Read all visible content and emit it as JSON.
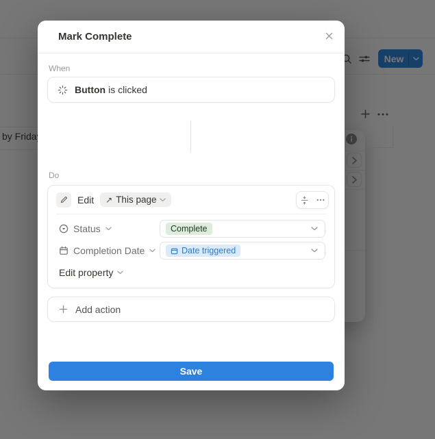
{
  "background": {
    "new_button": "New",
    "table_row_label": "by Friday"
  },
  "modal": {
    "title": "Mark Complete",
    "when": {
      "label": "When",
      "trigger_subject": "Button",
      "trigger_condition": "is clicked"
    },
    "do": {
      "label": "Do",
      "action": {
        "verb": "Edit",
        "target_arrow": "↗",
        "target": "This page",
        "properties": [
          {
            "name": "Status",
            "value": "Complete",
            "type": "status"
          },
          {
            "name": "Completion Date",
            "value": "Date triggered",
            "type": "date"
          }
        ],
        "edit_property": "Edit property"
      },
      "add_action": "Add action"
    },
    "save": "Save"
  },
  "icons": {
    "modal_close": "close-icon",
    "trigger": "button-click-icon",
    "action_verb": "pencil-icon",
    "property_status": "status-icon",
    "property_date": "calendar-icon",
    "action_toolbar": [
      "collapse-vertical-icon",
      "more-icon"
    ],
    "background": [
      "search-icon",
      "sliders-icon",
      "plus-icon",
      "more-icon",
      "info-icon",
      "chevron-right-icon"
    ]
  },
  "colors": {
    "accent_blue": "#2383e2",
    "save_button_blue": "#2c82de",
    "tag_green_bg": "#deecdb",
    "tag_green_text": "#1c3829",
    "tag_blue_bg": "#dbe9f8",
    "tag_blue_text": "#2d7cd4"
  }
}
